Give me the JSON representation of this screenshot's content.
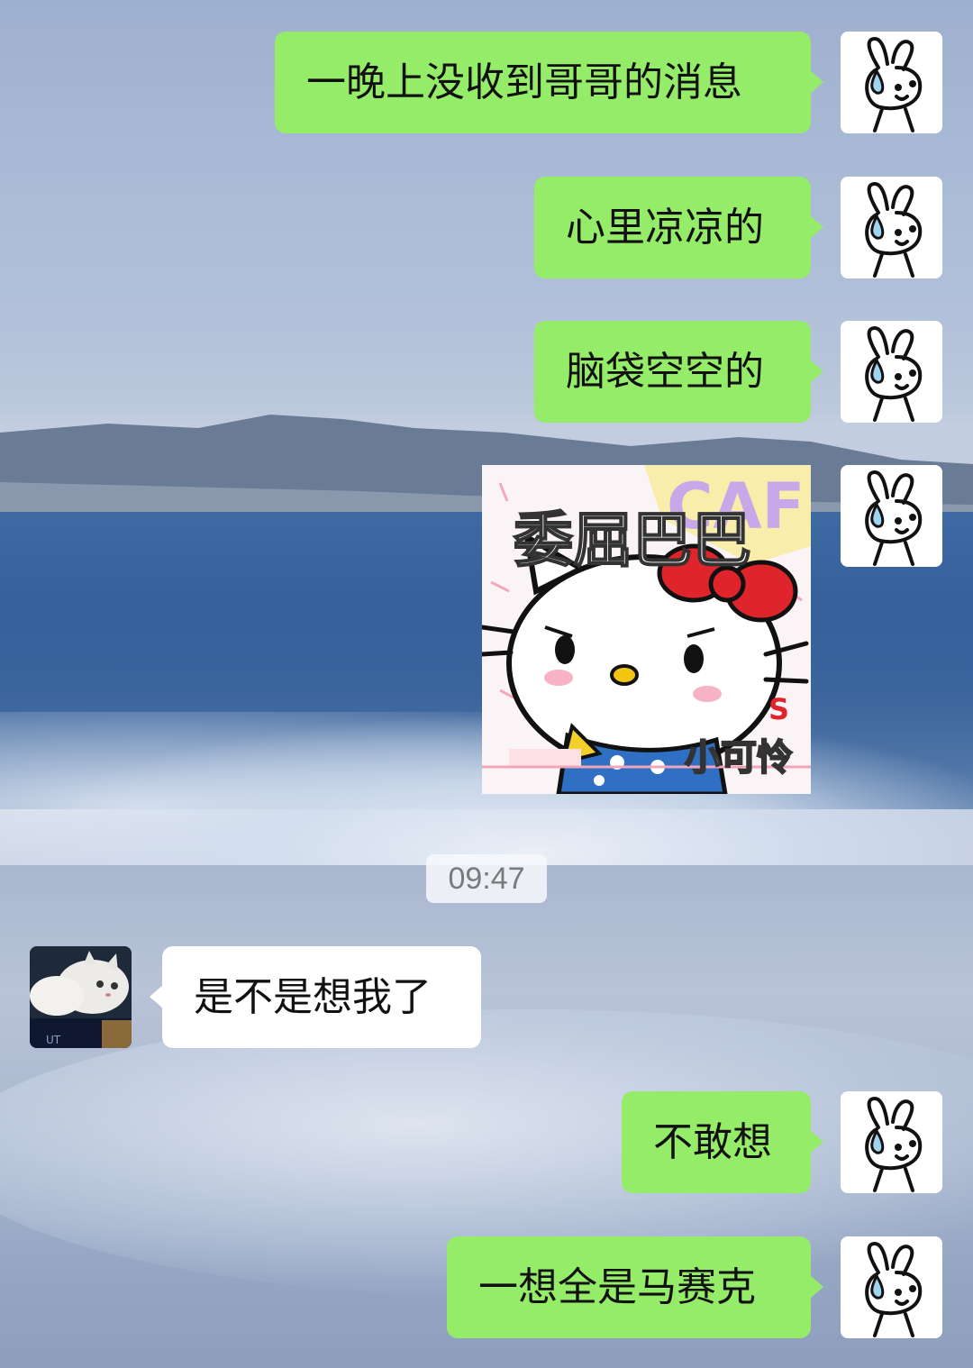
{
  "messages": [
    {
      "side": "me",
      "text": "一晚上没收到哥哥的消息"
    },
    {
      "side": "me",
      "text": "心里凉凉的"
    },
    {
      "side": "me",
      "text": "脑袋空空的"
    },
    {
      "side": "me",
      "type": "sticker",
      "caption_top": "委屈巴巴",
      "caption_bottom": "小可怜"
    },
    {
      "side": "them",
      "text": "是不是想我了"
    },
    {
      "side": "me",
      "text": "不敢想"
    },
    {
      "side": "me",
      "text": "一想全是马赛克"
    }
  ],
  "timestamp": "09:47",
  "colors": {
    "my_bubble": "#95ec69",
    "their_bubble": "#ffffff",
    "timestamp_text": "#7a7a7a"
  },
  "icons": {
    "my_avatar": "bunny-sweat-icon",
    "their_avatar": "white-cat-photo"
  }
}
